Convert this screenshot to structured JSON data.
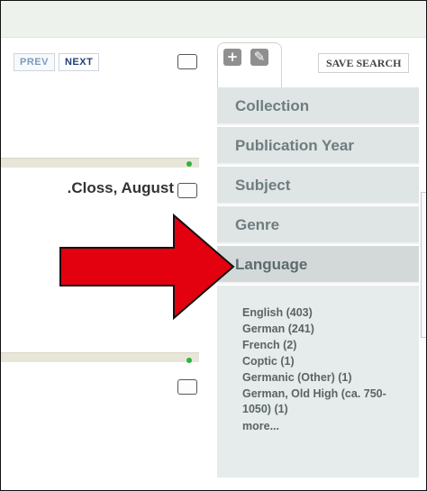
{
  "pager": {
    "prev_label": "PREV",
    "next_label": "NEXT"
  },
  "toolbar": {
    "save_search_label": "SAVE SEARCH"
  },
  "results": [
    {
      "author": "Closs, August."
    }
  ],
  "facets": [
    {
      "label": "Collection"
    },
    {
      "label": "Publication Year"
    },
    {
      "label": "Subject"
    },
    {
      "label": "Genre"
    },
    {
      "label": "Language"
    }
  ],
  "languages": [
    {
      "label": "English (403)"
    },
    {
      "label": "German (241)"
    },
    {
      "label": "French (2)"
    },
    {
      "label": "Coptic (1)"
    },
    {
      "label": "Germanic (Other) (1)"
    },
    {
      "label": "German, Old High (ca. 750-1050) (1)"
    },
    {
      "label": "more..."
    }
  ],
  "icons": {
    "add_tab": "plus-icon",
    "edit_tab": "edit-icon",
    "annotation": "red-arrow-icon"
  },
  "colors": {
    "arrow_fill": "#e3000f",
    "status_dot": "#2fb33a",
    "facet_bg": "#dfe4e4"
  }
}
